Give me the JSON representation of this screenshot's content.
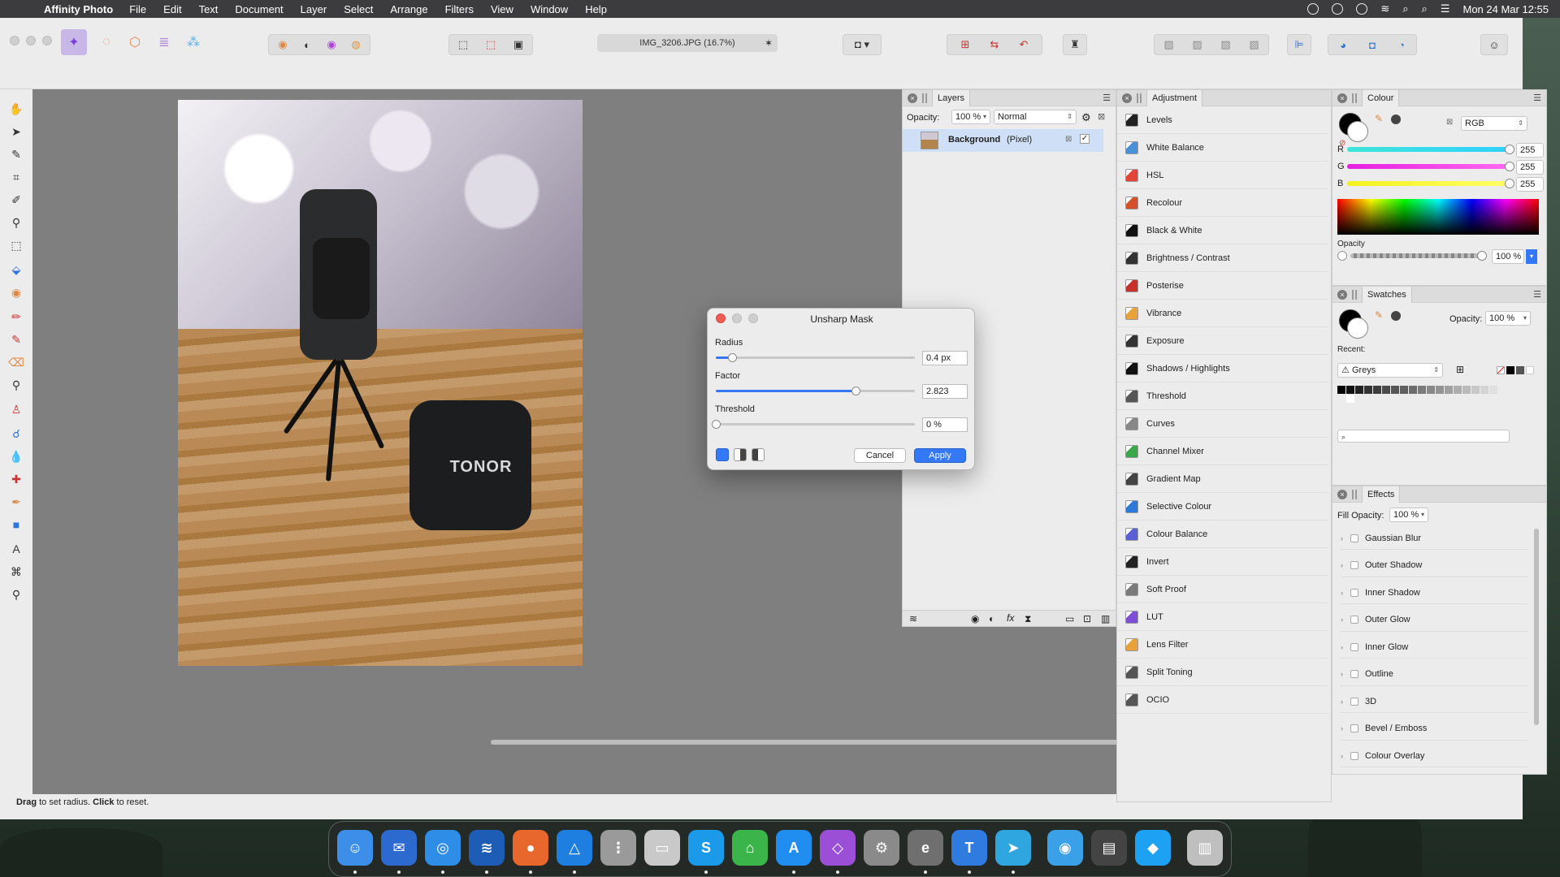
{
  "menubar": {
    "app_name": "Affinity Photo",
    "items": [
      "File",
      "Edit",
      "Text",
      "Document",
      "Layer",
      "Select",
      "Arrange",
      "Filters",
      "View",
      "Window",
      "Help"
    ],
    "clock": "Mon 24 Mar  12:55"
  },
  "document": {
    "tab_title": "IMG_3206.JPG (16.7%)",
    "tab_close": "✶",
    "photo_brand_text": "TONOR"
  },
  "status": {
    "hint_bold1": "Drag",
    "hint_text1": " to set radius. ",
    "hint_bold2": "Click",
    "hint_text2": " to reset."
  },
  "layers": {
    "tab": "Layers",
    "opacity_label": "Opacity:",
    "opacity_value": "100 %",
    "blend_mode": "Normal",
    "layer_name": "Background",
    "layer_type": "(Pixel)"
  },
  "adjustment": {
    "tab": "Adjustment",
    "items": [
      {
        "label": "Levels",
        "color": "#222222"
      },
      {
        "label": "White Balance",
        "color": "#4a90d9"
      },
      {
        "label": "HSL",
        "color": "#e4453a"
      },
      {
        "label": "Recolour",
        "color": "#d5512b"
      },
      {
        "label": "Black & White",
        "color": "#111111"
      },
      {
        "label": "Brightness / Contrast",
        "color": "#333333"
      },
      {
        "label": "Posterise",
        "color": "#c8302e"
      },
      {
        "label": "Vibrance",
        "color": "#e8a23a"
      },
      {
        "label": "Exposure",
        "color": "#333333"
      },
      {
        "label": "Shadows / Highlights",
        "color": "#111111"
      },
      {
        "label": "Threshold",
        "color": "#555555"
      },
      {
        "label": "Curves",
        "color": "#888888"
      },
      {
        "label": "Channel Mixer",
        "color": "#3aa84a"
      },
      {
        "label": "Gradient Map",
        "color": "#444444"
      },
      {
        "label": "Selective Colour",
        "color": "#2d7bd8"
      },
      {
        "label": "Colour Balance",
        "color": "#5b5fd6"
      },
      {
        "label": "Invert",
        "color": "#222222"
      },
      {
        "label": "Soft Proof",
        "color": "#7a7a7a"
      },
      {
        "label": "LUT",
        "color": "#7d4fd6"
      },
      {
        "label": "Lens Filter",
        "color": "#e8a23a"
      },
      {
        "label": "Split Toning",
        "color": "#555555"
      },
      {
        "label": "OCIO",
        "color": "#555555"
      }
    ]
  },
  "colour": {
    "tab": "Colour",
    "mode": "RGB",
    "r_label": "R",
    "r_value": "255",
    "g_label": "G",
    "g_value": "255",
    "b_label": "B",
    "b_value": "255",
    "opacity_label": "Opacity",
    "opacity_value": "100 %"
  },
  "swatches": {
    "tab": "Swatches",
    "opacity_label": "Opacity:",
    "opacity_value": "100 %",
    "recent_label": "Recent:",
    "palette": "Greys",
    "greys": [
      "#000000",
      "#111111",
      "#222222",
      "#333333",
      "#3c3c3c",
      "#4a4a4a",
      "#555555",
      "#606060",
      "#6d6d6d",
      "#7a7a7a",
      "#888888",
      "#939393",
      "#a0a0a0",
      "#adadad",
      "#bbbbbb",
      "#c8c8c8",
      "#d4d4d4",
      "#e0e0e0",
      "#ececec",
      "#ffffff"
    ]
  },
  "effects": {
    "tab": "Effects",
    "fill_opacity_label": "Fill Opacity:",
    "fill_opacity_value": "100 %",
    "items": [
      "Gaussian Blur",
      "Outer Shadow",
      "Inner Shadow",
      "Outer Glow",
      "Inner Glow",
      "Outline",
      "3D",
      "Bevel / Emboss",
      "Colour Overlay"
    ]
  },
  "dialog": {
    "title": "Unsharp Mask",
    "radius_label": "Radius",
    "radius_value": "0.4 px",
    "radius_fraction": 0.08,
    "factor_label": "Factor",
    "factor_value": "2.823",
    "factor_fraction": 0.7,
    "threshold_label": "Threshold",
    "threshold_value": "0 %",
    "threshold_fraction": 0.0,
    "cancel_label": "Cancel",
    "apply_label": "Apply"
  },
  "dock": {
    "apps": [
      {
        "name": "finder",
        "color": "#3d8ee8",
        "glyph": "☺"
      },
      {
        "name": "thunderbird",
        "color": "#2d6ad0",
        "glyph": "✉"
      },
      {
        "name": "safari",
        "color": "#2e8de6",
        "glyph": "◎"
      },
      {
        "name": "mission",
        "color": "#1e5db5",
        "glyph": "≋"
      },
      {
        "name": "firefox",
        "color": "#e8672c",
        "glyph": "●"
      },
      {
        "name": "affinity-designer",
        "color": "#1e7fe0",
        "glyph": "△"
      },
      {
        "name": "launchpad",
        "color": "#9a9a9a",
        "glyph": "⋮"
      },
      {
        "name": "preview",
        "color": "#c9c9c9",
        "glyph": "▭"
      },
      {
        "name": "skype",
        "color": "#1a9ae8",
        "glyph": "S"
      },
      {
        "name": "app-green",
        "color": "#3bb54a",
        "glyph": "⌂"
      },
      {
        "name": "app-store",
        "color": "#1f8ef0",
        "glyph": "A"
      },
      {
        "name": "affinity-photo",
        "color": "#9b4fd6",
        "glyph": "◇"
      },
      {
        "name": "system-settings",
        "color": "#8a8a8a",
        "glyph": "⚙"
      },
      {
        "name": "app-e",
        "color": "#6f6f6f",
        "glyph": "e"
      },
      {
        "name": "typora",
        "color": "#2f7be0",
        "glyph": "T"
      },
      {
        "name": "telegram",
        "color": "#2fa6e0",
        "glyph": "➤"
      },
      {
        "name": "network",
        "color": "#3aa1e8",
        "glyph": "◉"
      },
      {
        "name": "printer",
        "color": "#444444",
        "glyph": "▤"
      },
      {
        "name": "app-blue",
        "color": "#1da1f2",
        "glyph": "◆"
      },
      {
        "name": "trash",
        "color": "#bfbfbf",
        "glyph": "▥"
      }
    ]
  }
}
